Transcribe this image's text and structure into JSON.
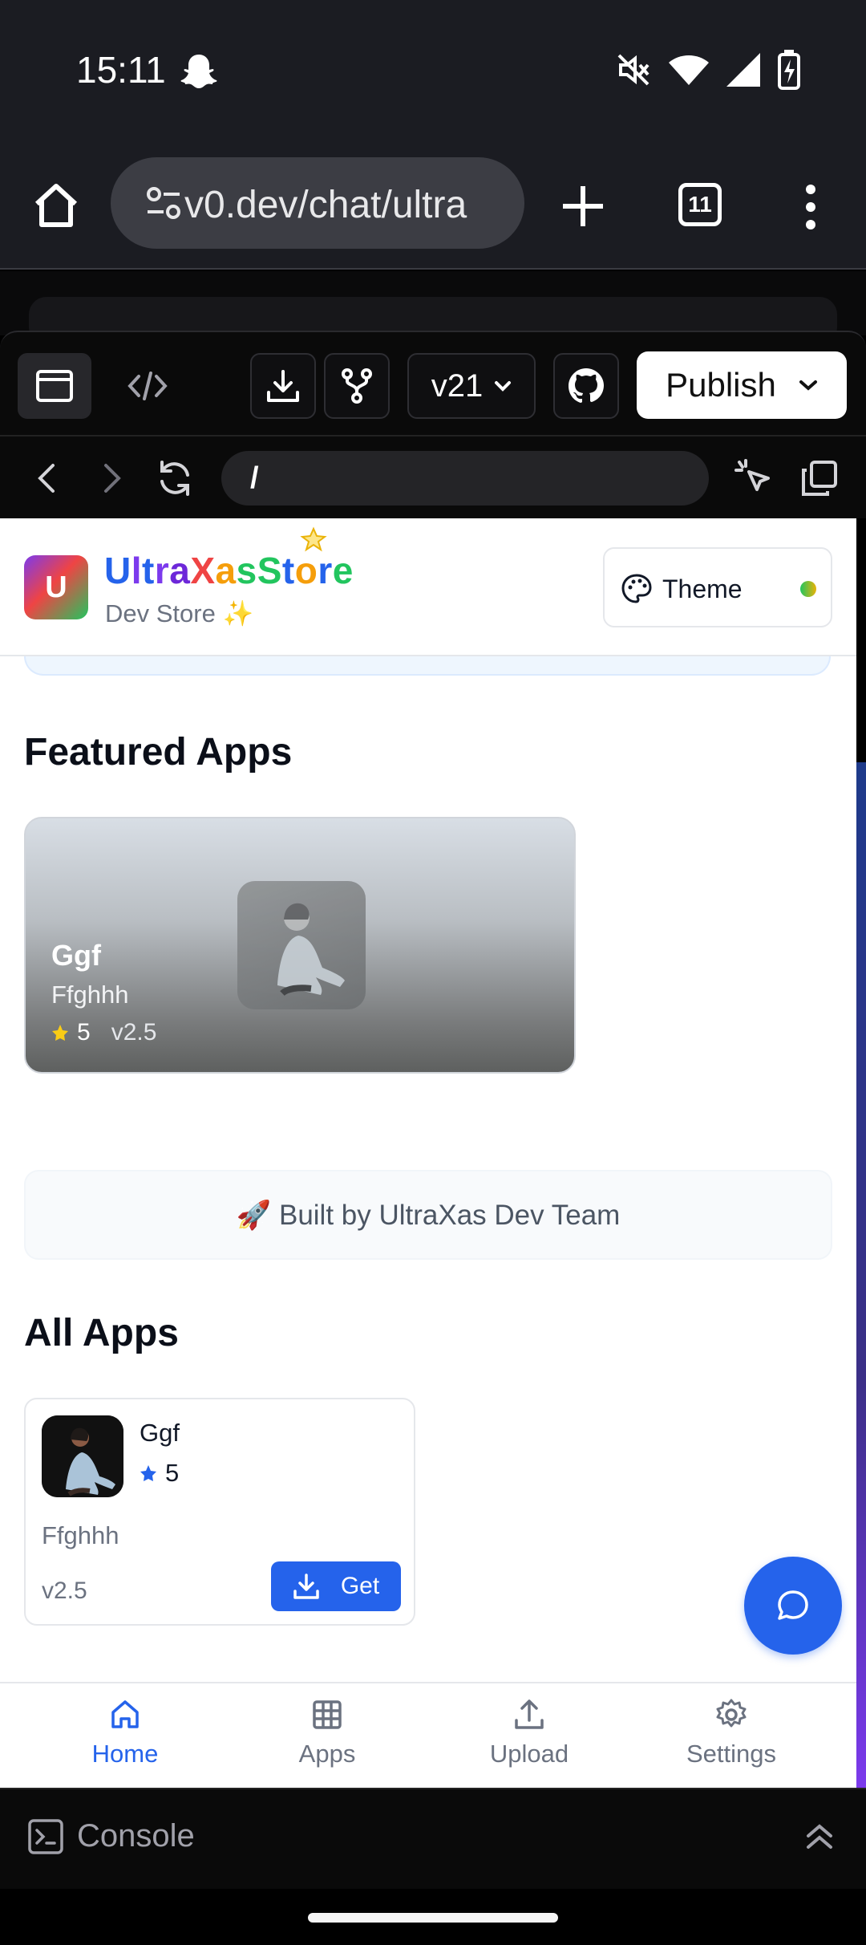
{
  "status_bar": {
    "time": "15:11",
    "icons": [
      "snapchat-ghost-icon",
      "mute-icon",
      "wifi-icon",
      "signal-icon",
      "battery-charging-icon"
    ]
  },
  "browser": {
    "url": "v0.dev/chat/ultra",
    "tab_count": "11",
    "icons": [
      "home-icon",
      "site-settings-icon",
      "new-tab-icon",
      "tabs-icon",
      "more-icon"
    ]
  },
  "v0_toolbar": {
    "version": "v21",
    "publish_label": "Publish",
    "icons": [
      "preview-icon",
      "code-icon",
      "download-icon",
      "fork-icon",
      "github-icon"
    ]
  },
  "v0_nav": {
    "path": "/"
  },
  "app": {
    "brand": {
      "title_letters": [
        {
          "ch": "U",
          "color": "#2563eb"
        },
        {
          "ch": "l",
          "color": "#7c3aed"
        },
        {
          "ch": "t",
          "color": "#2563eb"
        },
        {
          "ch": "r",
          "color": "#7c3aed"
        },
        {
          "ch": "a",
          "color": "#6d28d9"
        },
        {
          "ch": "X",
          "color": "#ef4444"
        },
        {
          "ch": "a",
          "color": "#f59e0b"
        },
        {
          "ch": "s",
          "color": "#22c55e"
        },
        {
          "ch": "S",
          "color": "#22c55e"
        },
        {
          "ch": "t",
          "color": "#2563eb"
        },
        {
          "ch": "o",
          "color": "#f59e0b"
        },
        {
          "ch": "r",
          "color": "#2563eb"
        },
        {
          "ch": "e",
          "color": "#22c55e"
        }
      ],
      "logo_letter": "U",
      "subtitle": "Dev Store ✨"
    },
    "theme_label": "Theme",
    "featured_title": "Featured Apps",
    "featured": {
      "name": "Ggf",
      "description": "Ffghhh",
      "rating": "5",
      "version": "v2.5"
    },
    "built_by": "🚀 Built by UltraXas Dev Team",
    "all_apps_title": "All Apps",
    "apps": [
      {
        "name": "Ggf",
        "rating": "5",
        "description": "Ffghhh",
        "version": "v2.5",
        "action": "Get"
      }
    ],
    "bottom_nav": [
      {
        "label": "Home",
        "icon": "home-icon",
        "active": true
      },
      {
        "label": "Apps",
        "icon": "grid-icon",
        "active": false
      },
      {
        "label": "Upload",
        "icon": "upload-icon",
        "active": false
      },
      {
        "label": "Settings",
        "icon": "gear-icon",
        "active": false
      }
    ],
    "accent_color": "#2563eb"
  },
  "console": {
    "label": "Console"
  }
}
